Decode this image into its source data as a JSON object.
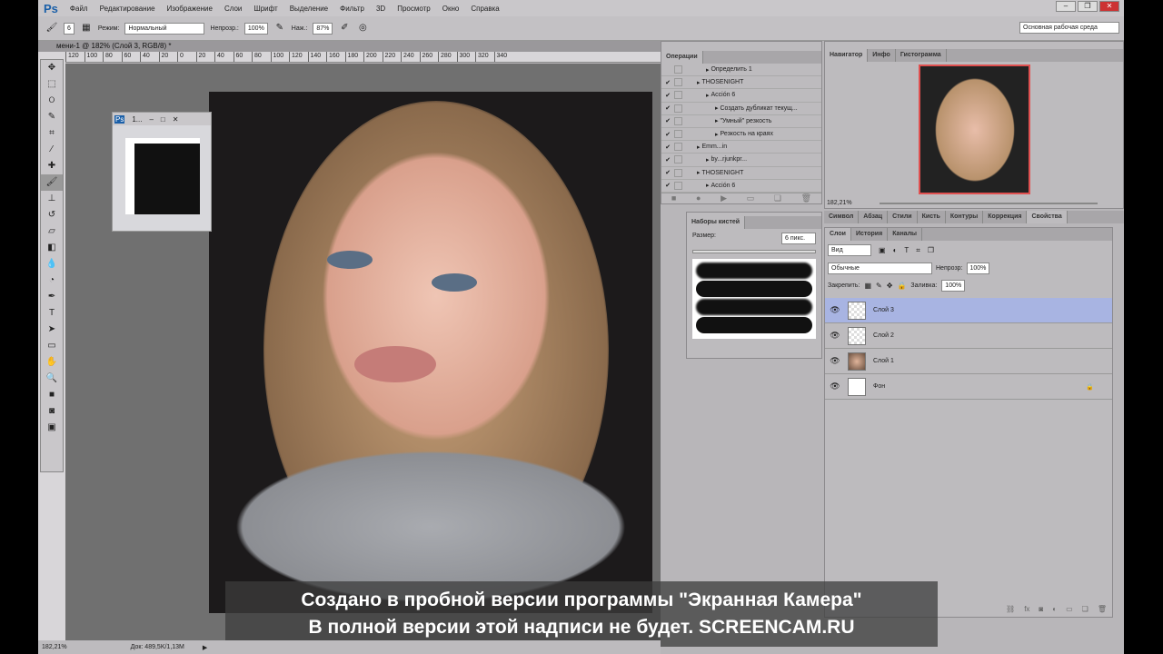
{
  "menu": {
    "logo": "Ps",
    "items": [
      "Файл",
      "Редактирование",
      "Изображение",
      "Слои",
      "Шрифт",
      "Выделение",
      "Фильтр",
      "3D",
      "Просмотр",
      "Окно",
      "Справка"
    ]
  },
  "options": {
    "brush_size": "6",
    "mode_label": "Режим:",
    "mode_value": "Нормальный",
    "opacity_label": "Непрозр.:",
    "opacity_value": "100%",
    "flow_label": "Наж.:",
    "flow_value": "87%",
    "workspace": "Основная рабочая среда"
  },
  "document": {
    "tab": "мени-1 @ 182% (Слой 3, RGB/8) *",
    "ruler_ticks": [
      "120",
      "100",
      "80",
      "60",
      "40",
      "20",
      "0",
      "20",
      "40",
      "60",
      "80",
      "100",
      "120",
      "140",
      "160",
      "180",
      "200",
      "220",
      "240",
      "260",
      "280",
      "300",
      "320",
      "340"
    ],
    "small_window_title": "1..."
  },
  "operations": {
    "tab": "Операции",
    "rows": [
      {
        "check": "",
        "indent": 2,
        "label": "Определить 1"
      },
      {
        "check": "✔",
        "indent": 1,
        "label": "THOSENIGHT"
      },
      {
        "check": "✔",
        "indent": 2,
        "label": "Acción 6"
      },
      {
        "check": "✔",
        "indent": 3,
        "label": "Создать дубликат текущ..."
      },
      {
        "check": "✔",
        "indent": 3,
        "label": "\"Умный\" резкость"
      },
      {
        "check": "✔",
        "indent": 3,
        "label": "Резкость на краях"
      },
      {
        "check": "✔",
        "indent": 1,
        "label": "Emm...in"
      },
      {
        "check": "✔",
        "indent": 2,
        "label": "by...rjunkpr..."
      },
      {
        "check": "✔",
        "indent": 1,
        "label": "THOSENIGHT"
      },
      {
        "check": "✔",
        "indent": 2,
        "label": "Acción 6"
      }
    ]
  },
  "brushes": {
    "tab": "Наборы кистей",
    "size_label": "Размер:",
    "size_value": "6 пикс."
  },
  "navigator": {
    "tabs": [
      "Навигатор",
      "Инфо",
      "Гистограмма"
    ],
    "zoom": "182,21%"
  },
  "props_tabs": [
    "Символ",
    "Абзац",
    "Стили",
    "Кисть",
    "Контуры",
    "Коррекция",
    "Свойства"
  ],
  "layers": {
    "tabs": [
      "Слои",
      "История",
      "Каналы"
    ],
    "filter": "Вид",
    "blend": "Обычные",
    "opacity_label": "Непрозр:",
    "opacity": "100%",
    "lock_label": "Закрепить:",
    "fill_label": "Заливка:",
    "fill": "100%",
    "items": [
      {
        "name": "Слой 3",
        "selected": true
      },
      {
        "name": "Слой 2"
      },
      {
        "name": "Слой 1"
      },
      {
        "name": "Фон",
        "locked": true
      }
    ]
  },
  "watermark": {
    "line1": "Создано в пробной версии программы \"Экранная Камера\"",
    "line2": "В полной версии этой надписи не будет. SCREENCAM.RU"
  },
  "status": {
    "zoom": "182,21%",
    "doc": "Док: 489,5K/1,13M"
  }
}
